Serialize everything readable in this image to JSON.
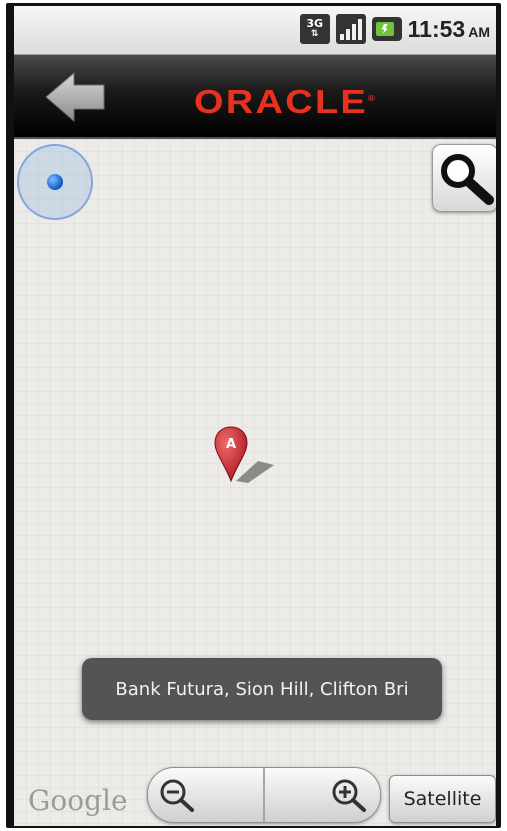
{
  "status_bar": {
    "network_type": "3G",
    "network_icon": "data-activity-icon",
    "signal_icon": "signal-strength-icon",
    "battery_icon": "battery-charging-icon",
    "time": "11:53",
    "ampm": "AM"
  },
  "title_bar": {
    "back_icon": "back-arrow-icon",
    "logo_text": "ORACLE",
    "logo_mark": "®",
    "brand_color": "#e8321f"
  },
  "map": {
    "my_location_icon": "my-location-icon",
    "search_icon": "search-icon",
    "marker": {
      "label": "A",
      "color": "#c8202a"
    },
    "toast_text": "Bank Futura, Sion Hill, Clifton Bri",
    "attribution": "Google",
    "zoom_out_icon": "zoom-out-icon",
    "zoom_in_icon": "zoom-in-icon",
    "satellite_label": "Satellite"
  }
}
